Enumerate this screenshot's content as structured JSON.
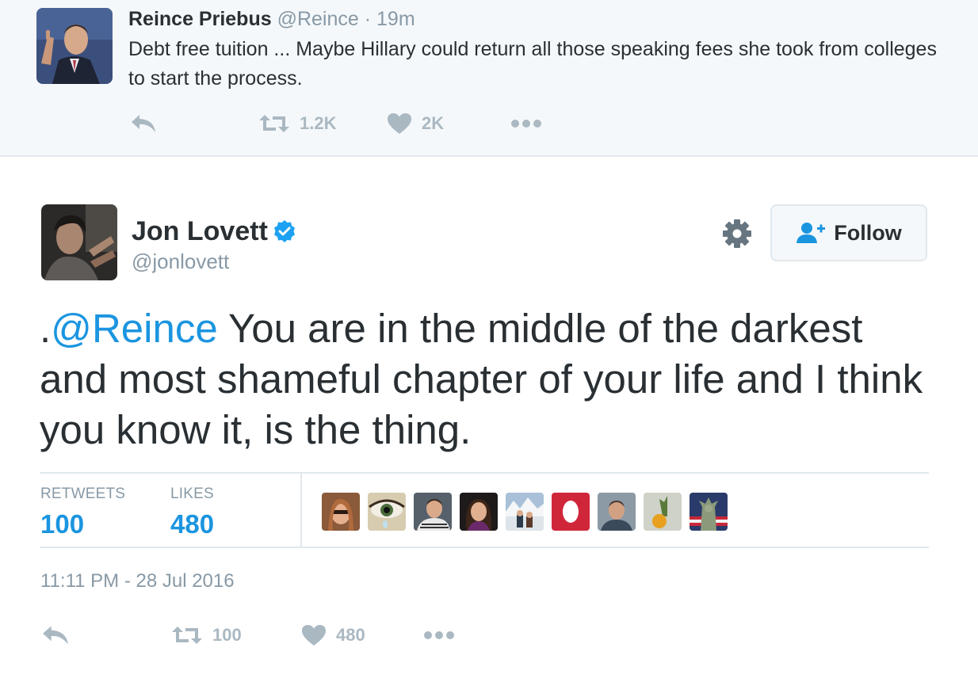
{
  "parent_tweet": {
    "name": "Reince Priebus",
    "handle": "@Reince",
    "separator": "·",
    "time": "19m",
    "text": "Debt free tuition ... Maybe Hillary could return all those speaking fees she took from colleges to start the process.",
    "actions": {
      "retweets": "1.2K",
      "likes": "2K"
    }
  },
  "main_tweet": {
    "name": "Jon Lovett",
    "handle": "@jonlovett",
    "follow_label": "Follow",
    "text_prefix": ".",
    "mention": "@Reince",
    "text_body": " You are in the middle of the darkest and most shameful chapter of your life and I think you know it, is the thing.",
    "stats": {
      "retweets_label": "RETWEETS",
      "retweets_value": "100",
      "likes_label": "LIKES",
      "likes_value": "480"
    },
    "timestamp": "11:11 PM - 28 Jul 2016",
    "actions": {
      "retweets": "100",
      "likes": "480"
    }
  },
  "colors": {
    "accent": "#1b95e0",
    "text": "#292f33",
    "muted": "#8899a6",
    "icon_muted": "#aab8c2",
    "border": "#e1e8ed",
    "parent_bg": "#f5f8fa",
    "verified": "#1da1f2"
  },
  "icons": [
    "reply-icon",
    "retweet-icon",
    "like-icon",
    "more-icon",
    "verified-badge-icon",
    "gear-icon",
    "follow-person-icon"
  ]
}
